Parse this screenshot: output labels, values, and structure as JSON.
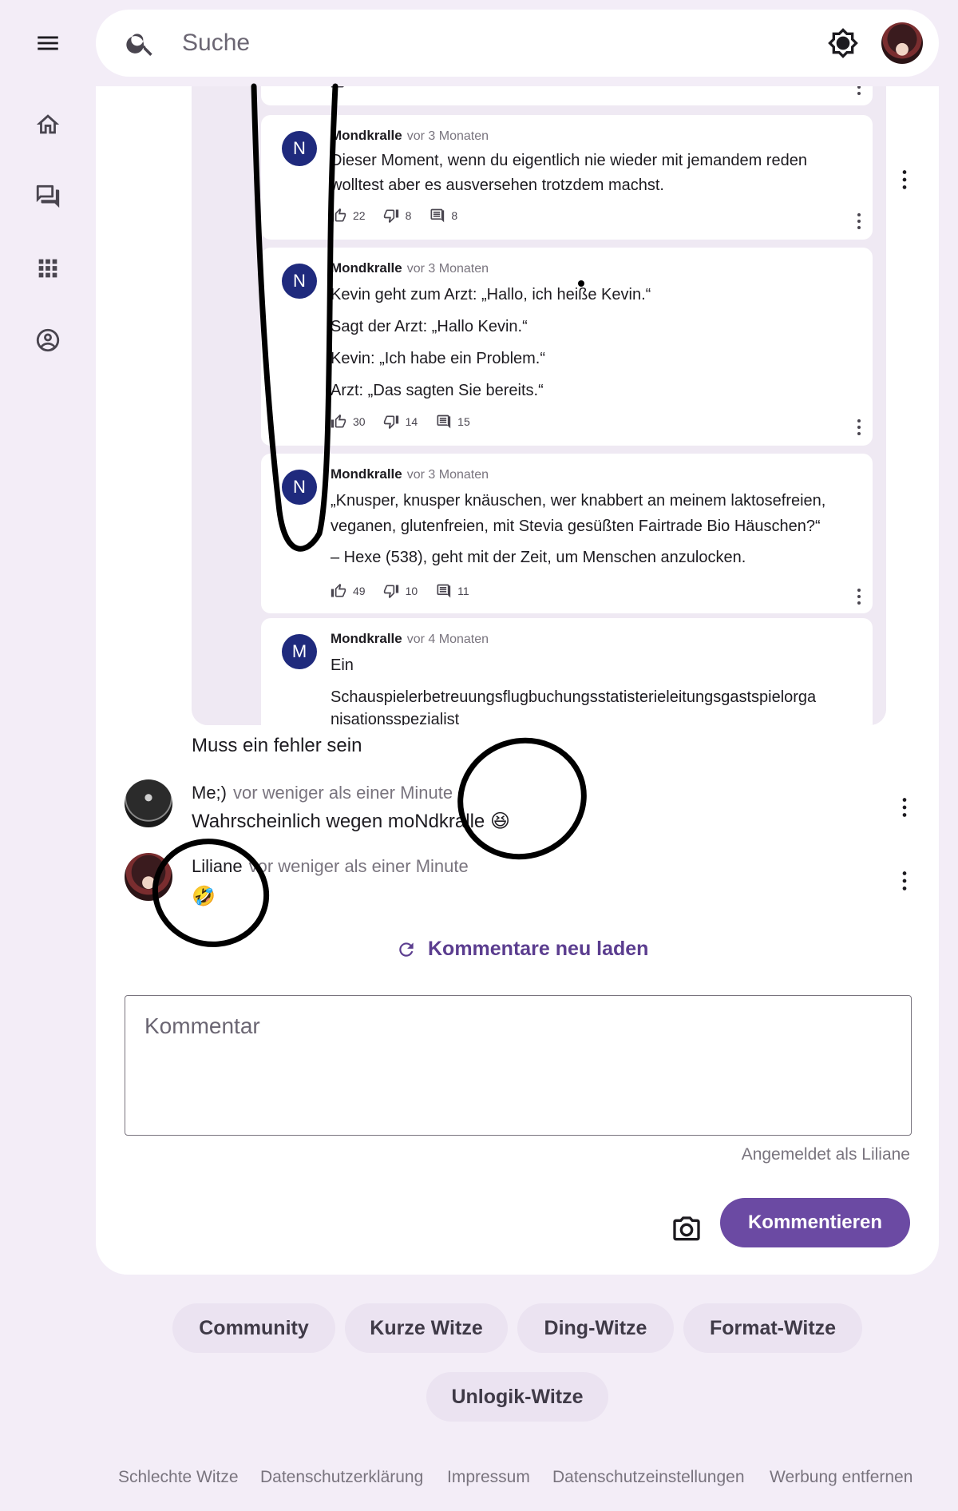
{
  "search": {
    "placeholder": "Suche"
  },
  "thread": {
    "replies": [
      {
        "avatar_letter": "N",
        "author": "Mondkralle",
        "time": "vor 3 Monaten",
        "lines": [
          "Dieser Moment, wenn du eigentlich nie wieder mit jemandem reden",
          "wolltest aber es ausversehen trotzdem machst."
        ],
        "likes": "22",
        "dislikes": "8",
        "comments": "8"
      },
      {
        "avatar_letter": "N",
        "author": "Mondkralle",
        "time": "vor 3 Monaten",
        "lines": [
          "Kevin geht zum Arzt: „Hallo, ich heiße Kevin.“",
          "Sagt der Arzt: „Hallo Kevin.“",
          "Kevin: „Ich habe ein Problem.“",
          "Arzt: „Das sagten Sie bereits.“"
        ],
        "likes": "30",
        "dislikes": "14",
        "comments": "15"
      },
      {
        "avatar_letter": "N",
        "author": "Mondkralle",
        "time": "vor 3 Monaten",
        "lines": [
          "„Knusper, knusper knäuschen, wer knabbert an meinem laktosefreien,",
          "veganen, glutenfreien, mit Stevia gesüßten Fairtrade Bio Häuschen?“",
          "– Hexe (538), geht mit der Zeit, um Menschen anzulocken."
        ],
        "likes": "49",
        "dislikes": "10",
        "comments": "11"
      },
      {
        "avatar_letter": "M",
        "author": "Mondkralle",
        "time": "vor 4 Monaten",
        "lines": [
          "Ein",
          "Schauspielerbetreuungsflugbuchungsstatisterieleitungsgastspielorga",
          "nisationsspezialist"
        ]
      }
    ]
  },
  "after_thread_text": "Muss ein fehler sein",
  "comments": [
    {
      "author": "Me;)",
      "time": "vor weniger als einer Minute",
      "text": "Wahrscheinlich wegen moNdkralle",
      "emoji": "😆"
    },
    {
      "author": "Liliane",
      "time": "vor weniger als einer Minute",
      "text": "",
      "emoji": "🤣"
    }
  ],
  "reload_label": "Kommentare neu laden",
  "comment_input": {
    "placeholder": "Kommentar"
  },
  "logged_in_as": "Angemeldet als Liliane",
  "submit_label": "Kommentieren",
  "categories": [
    "Community",
    "Kurze Witze",
    "Ding-Witze",
    "Format-Witze",
    "Unlogik-Witze"
  ],
  "footer_links": [
    "Schlechte Witze",
    "Datenschutzerklärung",
    "Impressum",
    "Datenschutzeinstellungen",
    "Werbung entfernen"
  ],
  "colors": {
    "accent": "#6b4aa3",
    "avatar_blue": "#1f2a7d",
    "background": "#f3edf7"
  }
}
